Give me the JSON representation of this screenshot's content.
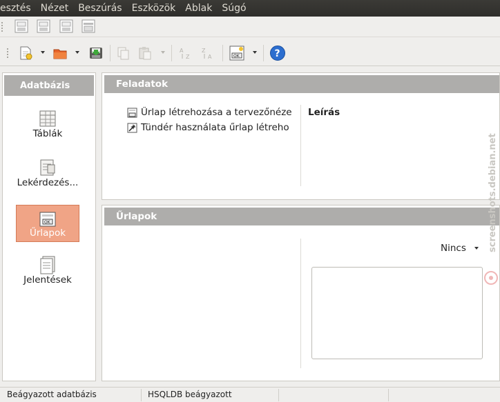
{
  "menu": [
    "esztés",
    "Nézet",
    "Beszúrás",
    "Eszközök",
    "Ablak",
    "Súgó"
  ],
  "left_panel": {
    "header": "Adatbázis",
    "items": [
      {
        "label": "Táblák",
        "icon": "tables-icon",
        "selected": false
      },
      {
        "label": "Lekérdezés...",
        "icon": "queries-icon",
        "selected": false
      },
      {
        "label": "Űrlapok",
        "icon": "forms-icon",
        "selected": true
      },
      {
        "label": "Jelentések",
        "icon": "reports-icon",
        "selected": false
      }
    ]
  },
  "tasks_panel": {
    "header": "Feladatok",
    "tasks": [
      {
        "label": "Űrlap létrehozása a tervezőnézet",
        "icon": "form-design-icon"
      },
      {
        "label": "Tündér használata űrlap létreho",
        "icon": "wizard-icon"
      }
    ],
    "description_title": "Leírás"
  },
  "forms_panel": {
    "header": "Űrlapok",
    "preview_select": "Nincs"
  },
  "statusbar": {
    "left": "Beágyazott adatbázis",
    "middle": "HSQLDB beágyazott"
  },
  "watermark": "screenshots.debian.net",
  "colors": {
    "menubar": "#3b3a36",
    "header": "#aeadab",
    "selected": "#f0a486",
    "help": "#2c6ecf"
  }
}
